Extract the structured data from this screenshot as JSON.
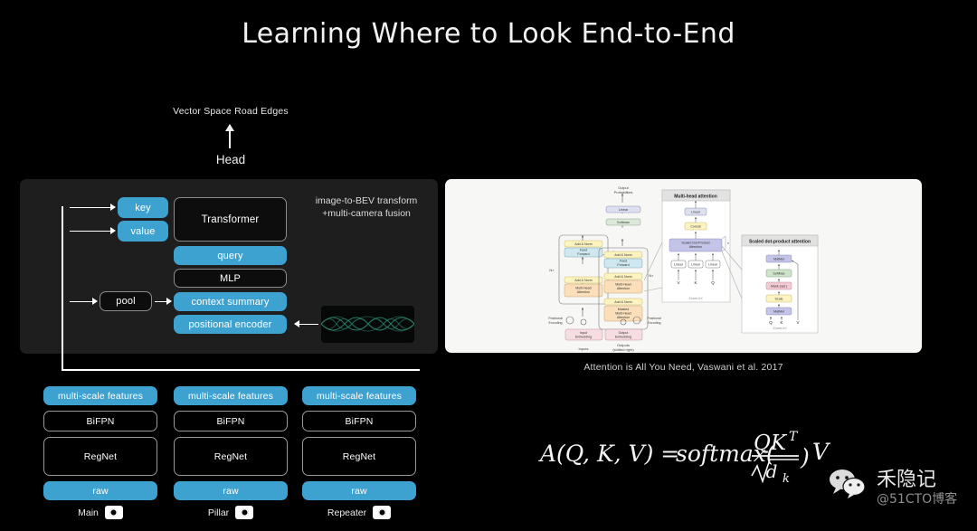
{
  "slide": {
    "title": "Learning Where to Look End-to-End",
    "background_color": "#000000",
    "accent_blue": "#3ea2d0",
    "panel_dark": "#1e1e1e",
    "panel_light": "#f7f7f5"
  },
  "head_section": {
    "output_label": "Vector Space Road Edges",
    "head_label": "Head",
    "arrow": "up-arrow"
  },
  "bev_panel": {
    "note_line1": "image-to-BEV transform",
    "note_line2": "+multi-camera fusion",
    "nodes": [
      {
        "id": "key",
        "label": "key",
        "style": "blue"
      },
      {
        "id": "value",
        "label": "value",
        "style": "blue"
      },
      {
        "id": "transformer",
        "label": "Transformer",
        "style": "outline"
      },
      {
        "id": "query",
        "label": "query",
        "style": "blue"
      },
      {
        "id": "mlp",
        "label": "MLP",
        "style": "outline"
      },
      {
        "id": "context-summary",
        "label": "context summary",
        "style": "blue"
      },
      {
        "id": "positional-encoder",
        "label": "positional encoder",
        "style": "blue"
      },
      {
        "id": "pool",
        "label": "pool",
        "style": "outline"
      }
    ],
    "wave_swatch": {
      "name": "sinusoid-positional-encoding-swatch",
      "color": "#2f8f74"
    }
  },
  "camera_columns": [
    {
      "camera": "Main",
      "icon": "camera-icon",
      "stack": [
        {
          "label": "multi-scale features",
          "style": "blue"
        },
        {
          "label": "BiFPN",
          "style": "outline"
        },
        {
          "label": "RegNet",
          "style": "outline"
        },
        {
          "label": "raw",
          "style": "blue"
        }
      ]
    },
    {
      "camera": "Pillar",
      "icon": "camera-icon",
      "stack": [
        {
          "label": "multi-scale features",
          "style": "blue"
        },
        {
          "label": "BiFPN",
          "style": "outline"
        },
        {
          "label": "RegNet",
          "style": "outline"
        },
        {
          "label": "raw",
          "style": "blue"
        }
      ]
    },
    {
      "camera": "Repeater",
      "icon": "camera-icon",
      "stack": [
        {
          "label": "multi-scale features",
          "style": "blue"
        },
        {
          "label": "BiFPN",
          "style": "outline"
        },
        {
          "label": "RegNet",
          "style": "outline"
        },
        {
          "label": "raw",
          "style": "blue"
        }
      ]
    }
  ],
  "paper_figure": {
    "caption": "Attention is All You Need, Vaswani et al. 2017",
    "architecture": {
      "top_label_line1": "Output",
      "top_label_line2": "Probabilities",
      "softmax": "Softmax",
      "linear": "Linear",
      "encoder_blocks": [
        "Add & Norm",
        "Feed Forward",
        "Add & Norm",
        "Multi-Head Attention"
      ],
      "decoder_blocks": [
        "Add & Norm",
        "Feed Forward",
        "Add & Norm",
        "Multi-Head Attention",
        "Add & Norm",
        "Masked Multi-Head Attention"
      ],
      "nx_label": "N×",
      "positional_encoding": "Positional Encoding",
      "input_embedding": "Input Embedding",
      "output_embedding": "Output Embedding",
      "inputs_label": "Inputs",
      "outputs_label_line1": "Outputs",
      "outputs_label_line2": "(shifted right)"
    },
    "multi_head_attention": {
      "title": "Multi-head attention",
      "blocks": [
        "Linear",
        "Concat",
        "Scaled Dot-Product Attention",
        "Linear",
        "Linear",
        "Linear"
      ],
      "inputs": [
        "V",
        "K",
        "Q"
      ],
      "h_label": "h",
      "zoom_caption": "Zoom-In!"
    },
    "scaled_dot_product": {
      "title": "Scaled dot-product attention",
      "blocks": [
        "MatMul",
        "SoftMax",
        "Mask (opt.)",
        "Scale",
        "MatMul"
      ],
      "inputs": [
        "Q",
        "K",
        "V"
      ],
      "zoom_caption": "Zoom-In!"
    }
  },
  "formula": {
    "text": "A(Q, K, V) = softmax(QKᵀ / √dₖ)V",
    "lhs": "A(Q, K, V)",
    "equals": "=",
    "fn": "softmax",
    "numerator": "QK",
    "numerator_sup": "T",
    "denominator": "d",
    "denominator_sub": "k",
    "trailing": "V"
  },
  "watermark": {
    "icon": "wechat-icon",
    "name": "禾隐记",
    "handle": "@51CTO博客"
  }
}
